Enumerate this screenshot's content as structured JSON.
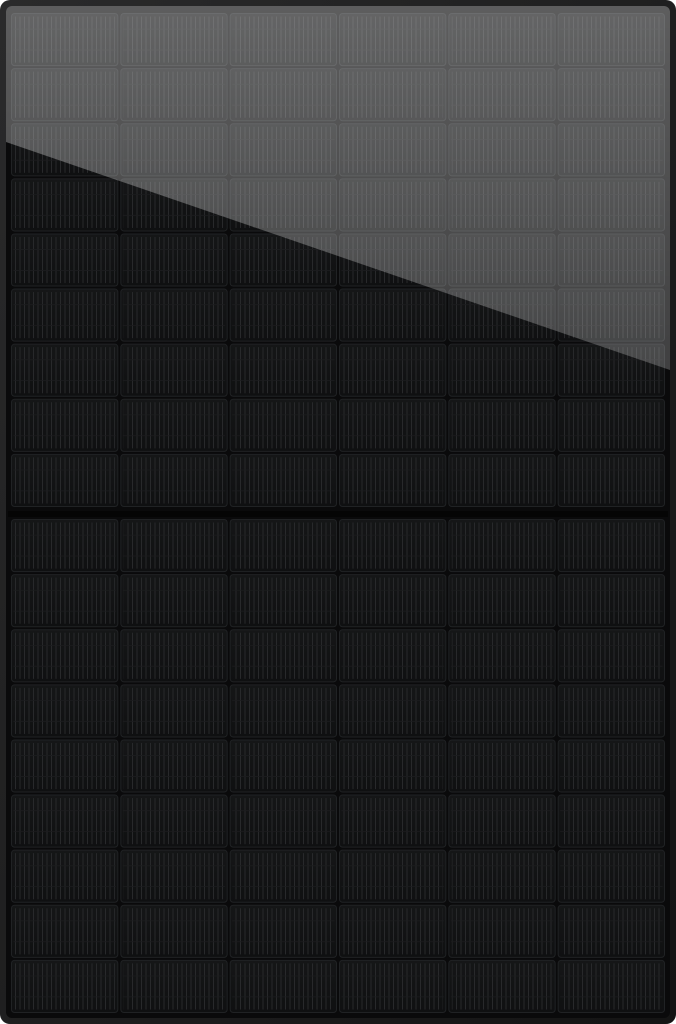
{
  "panel": {
    "subject": "solar panel",
    "columns": 6,
    "rows_per_half": 9,
    "halves": 2,
    "colors": {
      "frame": "#1a1a1a",
      "frame_edge": "#2b2b2b",
      "cell_dark": "#111213",
      "cell_border": "#202224",
      "finger_line": "#262729",
      "busbar_gap": "#050505",
      "glare_top": "#6a6b6d",
      "glare_bottom": "#4b4c4e"
    }
  }
}
